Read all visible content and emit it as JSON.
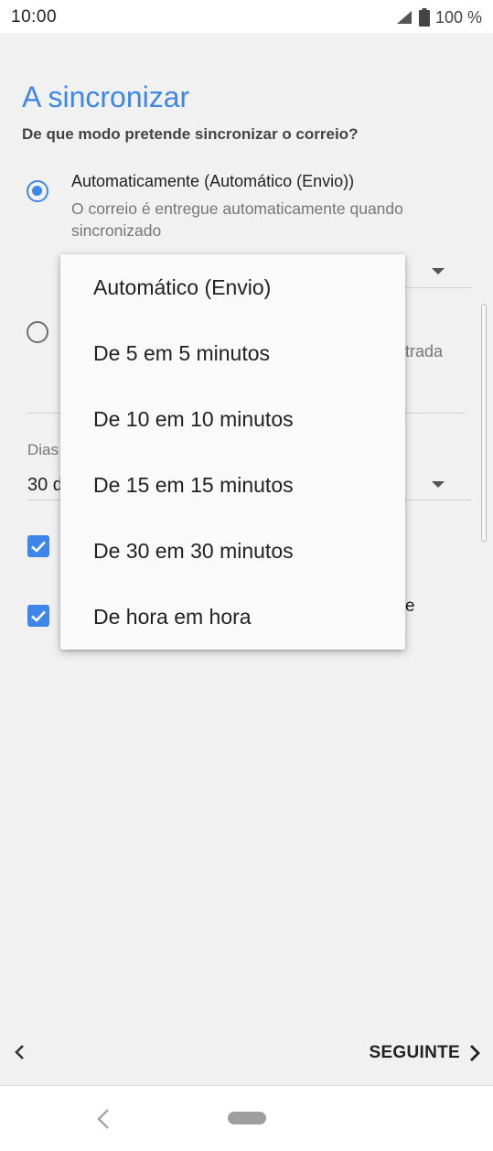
{
  "status_bar": {
    "time": "10:00",
    "battery": "100 %",
    "icons": [
      "signal-icon",
      "battery-icon"
    ]
  },
  "page": {
    "title": "A sincronizar",
    "subtitle": "De que modo pretende sincronizar o correio?",
    "option1": {
      "title": "Automaticamente (Automático (Envio))",
      "description": "O correio é entregue automaticamente quando sincronizado",
      "selected": true
    },
    "option2_partial": "trada",
    "days_label_partial": "Dias",
    "days_value_partial": "30 d",
    "checkbox2_partial": "e"
  },
  "menu": {
    "items": [
      "Automático (Envio)",
      "De 5 em 5 minutos",
      "De 10 em 10 minutos",
      "De 15 em 15 minutos",
      "De 30 em 30 minutos",
      "De hora em hora"
    ]
  },
  "footer": {
    "next_label": "SEGUINTE"
  },
  "colors": {
    "accent": "#3f86ea",
    "background": "#f1f1f1"
  }
}
